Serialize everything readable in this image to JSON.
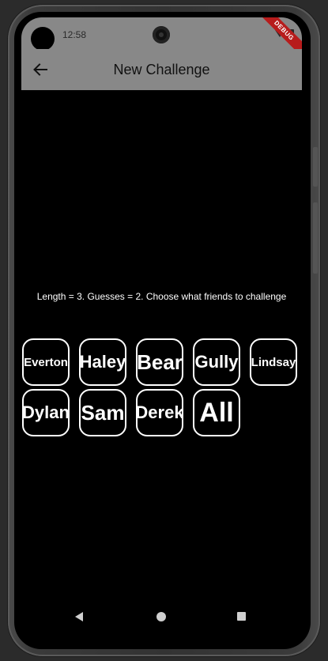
{
  "status_bar": {
    "time": "12:58",
    "debug_banner": "DEBUG"
  },
  "app_bar": {
    "title": "New Challenge",
    "back_icon": "arrow-back-icon"
  },
  "info_text": "Length = 3.   Guesses = 2.   Choose what friends to challenge",
  "friends": [
    {
      "label": "Everton"
    },
    {
      "label": "Haley"
    },
    {
      "label": "Bear"
    },
    {
      "label": "Gully"
    },
    {
      "label": "Lindsay"
    },
    {
      "label": "Dylan"
    },
    {
      "label": "Sam"
    },
    {
      "label": "Derek"
    },
    {
      "label": "All"
    }
  ],
  "nav_bar": {
    "back_icon": "nav-back-icon",
    "home_icon": "nav-home-icon",
    "recents_icon": "nav-recents-icon"
  },
  "colors": {
    "app_bar": "#888888",
    "background": "#000000",
    "button_border": "#ffffff",
    "text": "#ffffff",
    "debug_ribbon": "#b71c1c"
  }
}
